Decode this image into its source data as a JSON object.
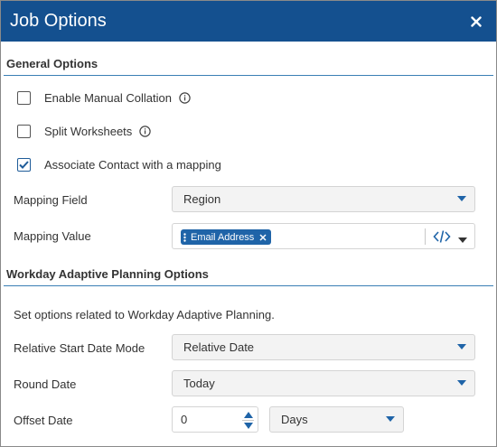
{
  "dialog": {
    "title": "Job Options",
    "close_icon": "close-icon"
  },
  "general": {
    "header": "General Options",
    "checks": [
      {
        "label": "Enable Manual Collation",
        "checked": false,
        "info": true
      },
      {
        "label": "Split Worksheets",
        "checked": false,
        "info": true
      },
      {
        "label": "Associate Contact with a mapping",
        "checked": true,
        "info": false
      }
    ],
    "mapping_field": {
      "label": "Mapping Field",
      "value": "Region"
    },
    "mapping_value": {
      "label": "Mapping Value",
      "tag": "Email Address"
    }
  },
  "adaptive": {
    "header": "Workday Adaptive Planning Options",
    "description": "Set options related to Workday Adaptive Planning.",
    "relative_start": {
      "label": "Relative Start Date Mode",
      "value": "Relative Date"
    },
    "round_date": {
      "label": "Round Date",
      "value": "Today"
    },
    "offset_date": {
      "label": "Offset Date",
      "value": "0",
      "unit": "Days"
    }
  },
  "colors": {
    "titlebar": "#14508f",
    "accent": "#1f64a8",
    "rule": "#3a7fb5"
  }
}
